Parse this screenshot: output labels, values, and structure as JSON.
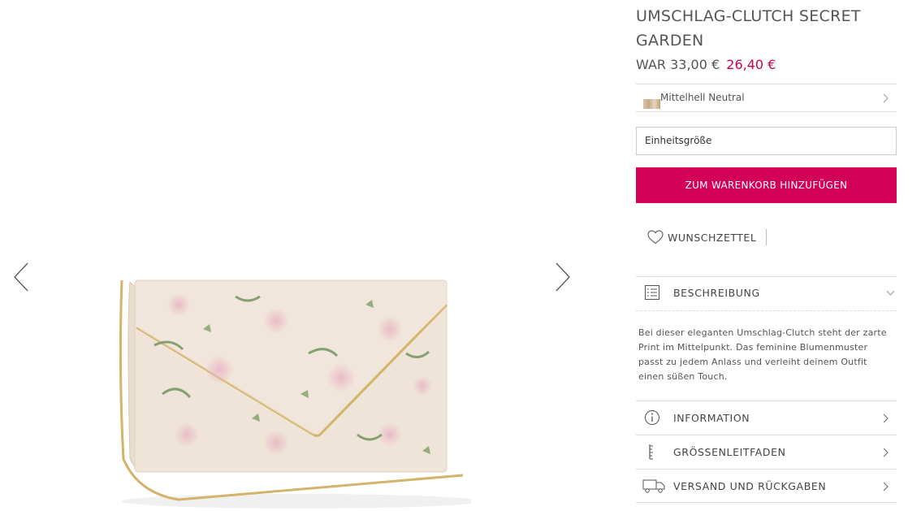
{
  "gallery": {
    "prev_icon": "chevron-left-icon",
    "next_icon": "chevron-right-icon",
    "image": "floral-envelope-clutch-bag"
  },
  "product": {
    "title": "UMSCHLAG-CLUTCH SECRET GARDEN",
    "price_was": "WAR 33,00 €",
    "price_now": "26,40 €",
    "sale_color": "#c8004f"
  },
  "color_select": {
    "value": "Mittelhell Neutral",
    "icon": "chevron-right-icon"
  },
  "size_select": {
    "value": "Einheitsgröße"
  },
  "cart_button": {
    "label": "ZUM WARENKORB HINZUFÜGEN",
    "color": "#d30058"
  },
  "wishlist": {
    "label": "WUNSCHZETTEL",
    "icon": "heart-icon"
  },
  "description": {
    "heading": "BESCHREIBUNG",
    "icon": "list-icon",
    "text": "Bei dieser eleganten Umschlag-Clutch steht der zarte Print im Mittelpunkt. Das feminine Blumenmuster passt zu jedem Anlass und verleiht deinem Outfit einen süßen Touch."
  },
  "sections": {
    "information": {
      "label": "INFORMATION",
      "icon": "info-icon"
    },
    "size_guide": {
      "label": "GRÖSSENLEITFADEN",
      "icon": "ruler-icon"
    },
    "shipping": {
      "label": "VERSAND UND RÜCKGABEN",
      "icon": "truck-icon"
    }
  }
}
